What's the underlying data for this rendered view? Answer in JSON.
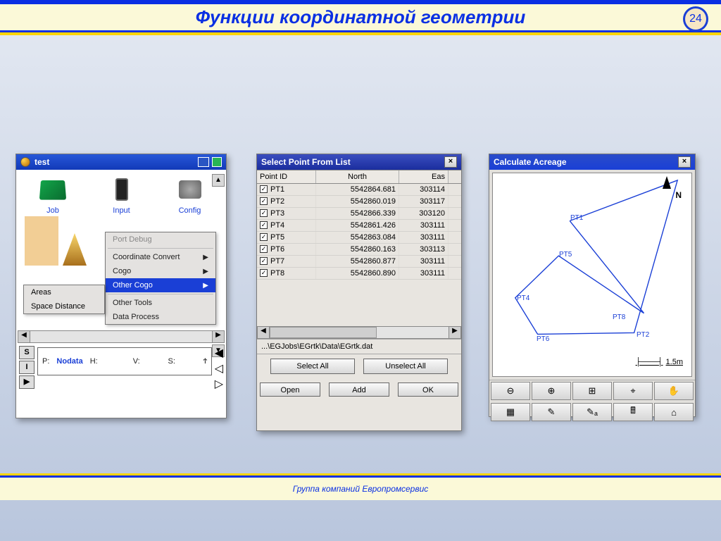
{
  "slide": {
    "title": "Функции координатной геометрии",
    "number": "24"
  },
  "footer": {
    "text": "Группа компаний Европромсервис"
  },
  "panel1": {
    "title": "test",
    "icons": {
      "job": "Job",
      "input": "Input",
      "config": "Config"
    },
    "menu": {
      "port_debug": "Port Debug",
      "coord_convert": "Coordinate Convert",
      "cogo": "Cogo",
      "other_cogo": "Other Cogo",
      "other_tools": "Other Tools",
      "data_process": "Data Process"
    },
    "submenu": {
      "areas": "Areas",
      "space_distance": "Space Distance"
    },
    "status": {
      "p": "P:",
      "nodata": "Nodata",
      "h": "H:",
      "v": "V:",
      "s": "S:",
      "ant": "Ϯ"
    },
    "si_buttons": {
      "s": "S",
      "i": "I",
      "b": "▶"
    }
  },
  "panel2": {
    "title": "Select Point From List",
    "headers": {
      "id": "Point ID",
      "north": "North",
      "east": "Eas"
    },
    "rows": [
      {
        "id": "PT1",
        "north": "5542864.681",
        "east": "303114"
      },
      {
        "id": "PT2",
        "north": "5542860.019",
        "east": "303117"
      },
      {
        "id": "PT3",
        "north": "5542866.339",
        "east": "303120"
      },
      {
        "id": "PT4",
        "north": "5542861.426",
        "east": "303111"
      },
      {
        "id": "PT5",
        "north": "5542863.084",
        "east": "303111"
      },
      {
        "id": "PT6",
        "north": "5542860.163",
        "east": "303113"
      },
      {
        "id": "PT7",
        "north": "5542860.877",
        "east": "303111"
      },
      {
        "id": "PT8",
        "north": "5542860.890",
        "east": "303111"
      }
    ],
    "path": "...\\EGJobs\\EGrtk\\Data\\EGrtk.dat",
    "btn_select_all": "Select All",
    "btn_unselect_all": "Unselect All",
    "btn_open": "Open",
    "btn_add": "Add",
    "btn_ok": "OK"
  },
  "panel3": {
    "title": "Calculate Acreage",
    "north_label": "N",
    "scale": "1.5m",
    "labels": {
      "pt1": "PT1",
      "pt2": "PT2",
      "pt4": "PT4",
      "pt5": "PT5",
      "pt6": "PT6",
      "pt8": "PT8"
    },
    "toolbar": {
      "zoom_out": "⊖",
      "zoom_in": "⊕",
      "zoom_ext": "⊞",
      "zoom_win": "⌖",
      "pan": "✋",
      "grid": "▦",
      "draw1": "✎",
      "draw2": "✎ₐ",
      "calc": "🖩",
      "home": "⌂"
    }
  }
}
